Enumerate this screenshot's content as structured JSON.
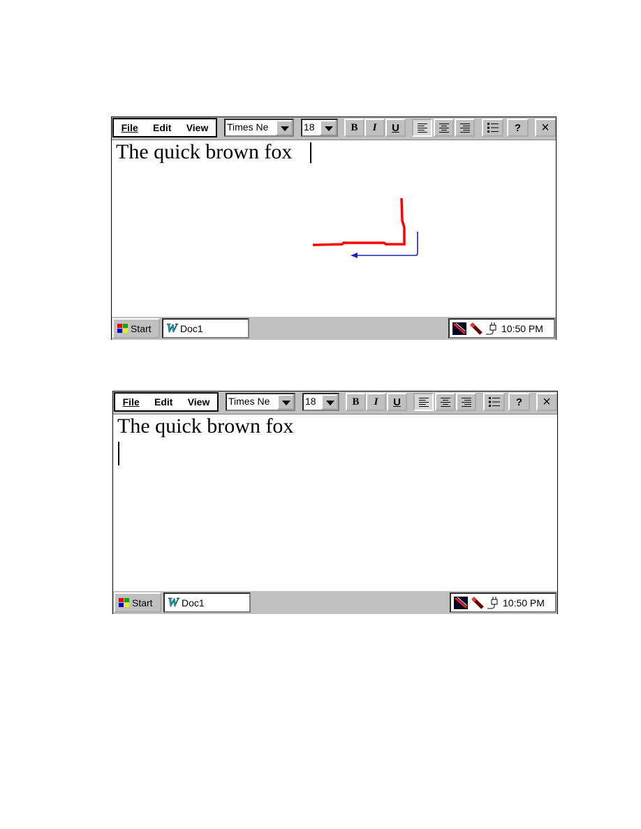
{
  "screens": [
    {
      "menu": {
        "file": "File",
        "edit": "Edit",
        "view": "View"
      },
      "font": "Times Ne",
      "size": "18",
      "format": {
        "bold": "B",
        "italic": "I",
        "underline": "U"
      },
      "help": "?",
      "close": "×",
      "document_text": "The quick brown fox",
      "caret_position": "end-of-line-1",
      "taskbar": {
        "start": "Start",
        "task": "Doc1",
        "clock": "10:50 PM"
      },
      "pen_strokes": {
        "gesture_color": "#ff0000",
        "indicator_color": "#2020c0"
      }
    },
    {
      "menu": {
        "file": "File",
        "edit": "Edit",
        "view": "View"
      },
      "font": "Times Ne",
      "size": "18",
      "format": {
        "bold": "B",
        "italic": "I",
        "underline": "U"
      },
      "help": "?",
      "close": "×",
      "document_text": "The quick brown fox",
      "caret_position": "start-of-line-2",
      "taskbar": {
        "start": "Start",
        "task": "Doc1",
        "clock": "10:50 PM"
      }
    }
  ]
}
